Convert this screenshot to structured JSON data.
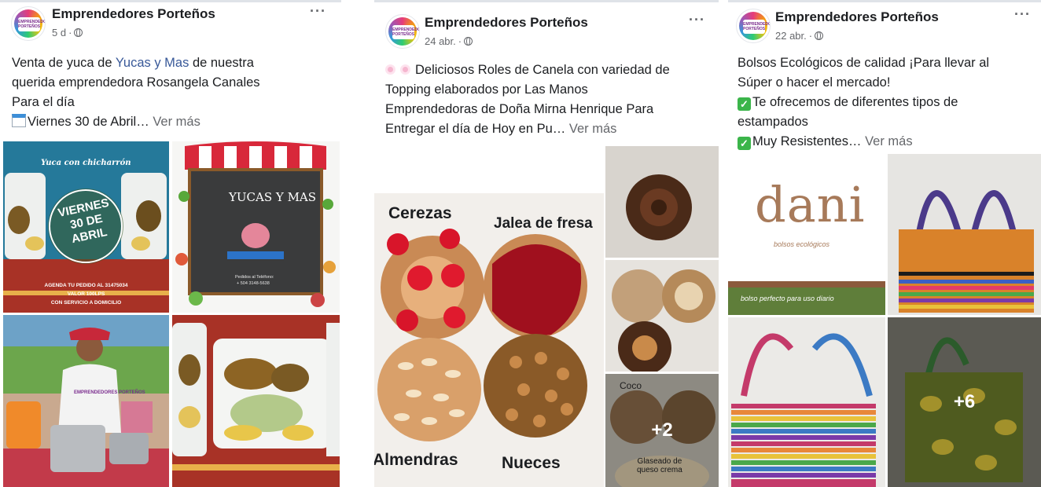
{
  "posts": [
    {
      "page_name": "Emprendedores Porteños",
      "time": "5 d",
      "text_prefix": "Venta de yuca de ",
      "text_link": "Yucas y Mas",
      "text_suffix": " de nuestra",
      "line2": "querida emprendedora Rosangela Canales",
      "line3": "Para el día",
      "line4": "Viernes 30 de Abril…",
      "see_more": "Ver más",
      "images": {
        "banner_title": "Yuca con chicharrón",
        "badge": [
          "VIERNES",
          "30 DE",
          "ABRIL"
        ],
        "banner_footer": [
          "AGENDA TU PEDIDO AL 31475034",
          "VALOR 100LPS",
          "CON SERVICIO A DOMICILIO"
        ],
        "store_name": "YUCAS Y MAS",
        "store_sub": "Pedidos al Teléfono:",
        "store_phone": "+ 504 3148-5638",
        "shirt_text": "EMPRENDEDORES PORTEÑOS"
      }
    },
    {
      "page_name": "Emprendedores Porteños",
      "time": "24 abr.",
      "line1": "Deliciosos Roles de Canela con variedad de",
      "line2": "Topping elaborados por Las Manos",
      "line3": "Emprendedoras de Doña Mirna Henrique Para",
      "line4": "Entregar el día de Hoy en Pu…",
      "see_more": "Ver más",
      "labels": {
        "cerezas": "Cerezas",
        "jalea": "Jalea de fresa",
        "almendras": "Almendras",
        "nueces": "Nueces",
        "coco": "Coco",
        "glaseado": [
          "Glaseado de",
          "queso crema"
        ]
      },
      "more_count": "+2"
    },
    {
      "page_name": "Emprendedores Porteños",
      "time": "22 abr.",
      "line1": "Bolsos Ecológicos de calidad ¡Para llevar al",
      "line2": "Súper o hacer el mercado!",
      "line3": "Te ofrecemos de diferentes tipos de",
      "line4": "estampados",
      "line5": "Muy Resistentes…",
      "see_more": "Ver más",
      "brand": "dani",
      "brand_sub": "bolsos ecológicos",
      "brand_tagline": "bolso perfecto para uso diario",
      "more_count": "+6"
    }
  ],
  "more_icon": "more-horizontal-icon",
  "privacy_icon": "globe-icon"
}
